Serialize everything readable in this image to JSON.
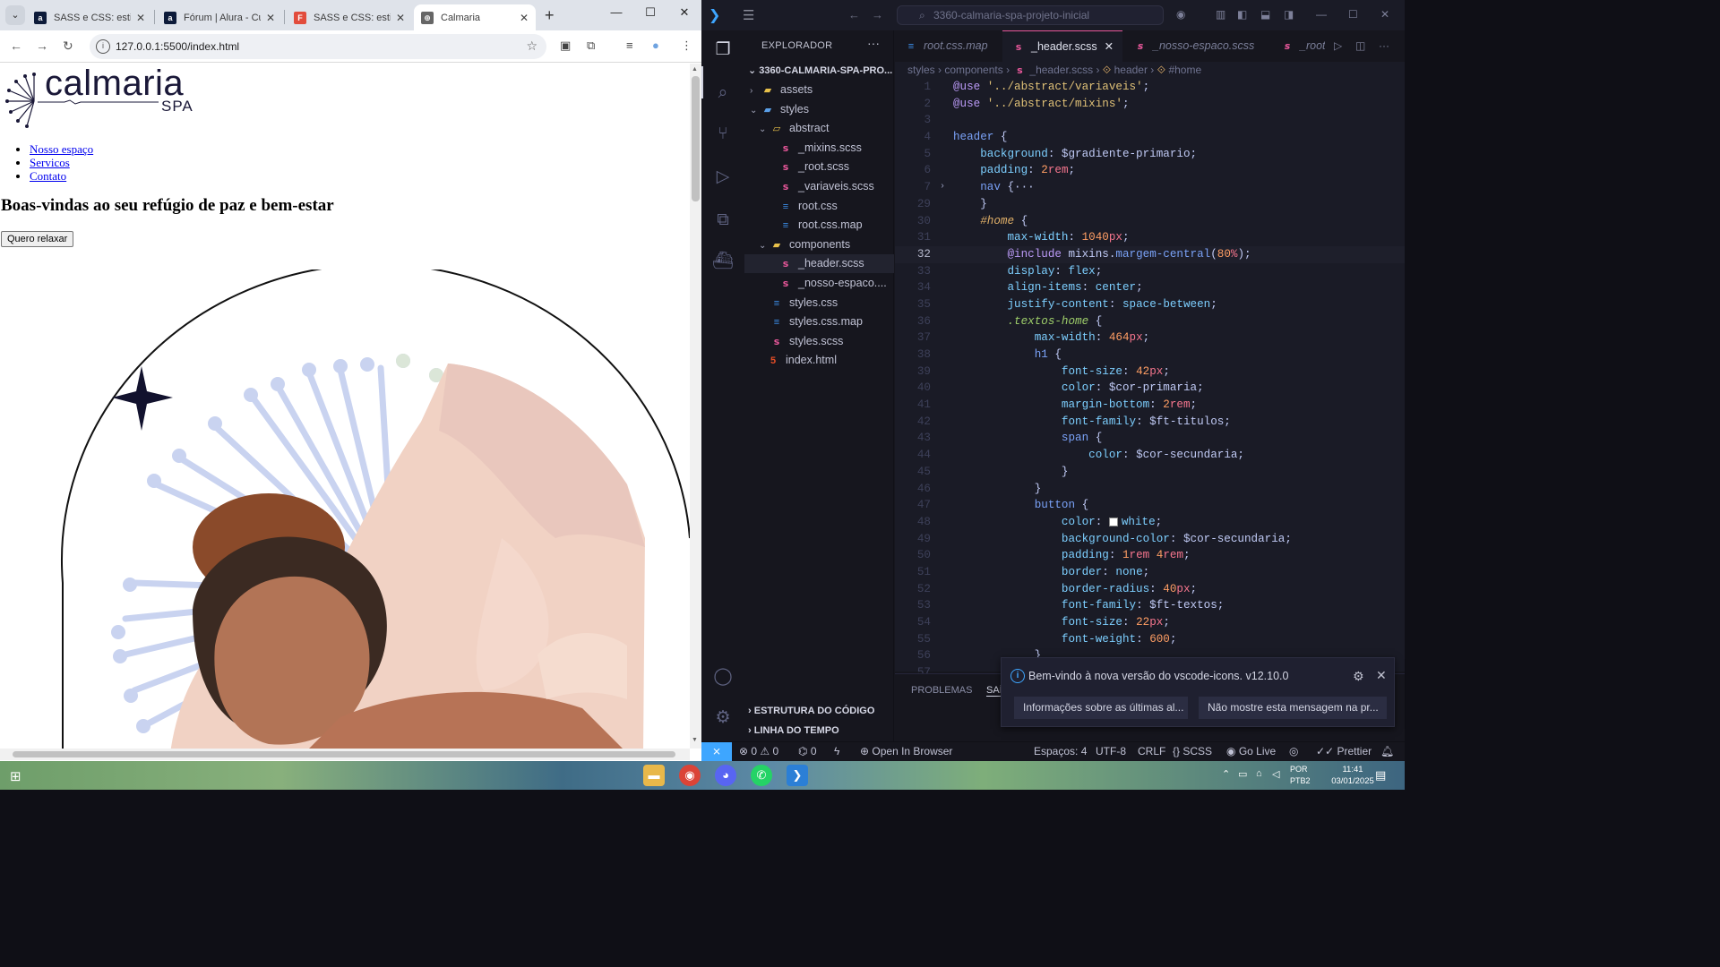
{
  "browser": {
    "tabs": [
      {
        "title": "SASS e CSS: estiliza",
        "favicon": "alura-icon",
        "fav_letter": "a",
        "color": "#0d1b3a"
      },
      {
        "title": "Fórum | Alura - Cur",
        "favicon": "alura-icon",
        "fav_letter": "a",
        "color": "#0d1b3a"
      },
      {
        "title": "SASS e CSS: estiliza",
        "favicon": "figma-icon",
        "fav_letter": "F",
        "color": "#e24c3c"
      },
      {
        "title": "Calmaria",
        "favicon": "globe-icon",
        "fav_letter": "⊕",
        "color": "#666666",
        "active": true
      }
    ],
    "url": "127.0.0.1:5500/index.html",
    "page": {
      "logo_word": "calmaria",
      "logo_sub": "SPA",
      "nav_links": [
        "Nosso espaço",
        "Servicos",
        "Contato"
      ],
      "heading": "Boas-vindas ao seu refúgio de paz e bem-estar",
      "button_label": "Quero relaxar"
    }
  },
  "vscode": {
    "search_text": "3360-calmaria-spa-projeto-inicial",
    "explorer_title": "EXPLORADOR",
    "project_root": "3360-CALMARIA-SPA-PRO...",
    "tree": [
      {
        "label": "assets",
        "type": "folder",
        "depth": 0,
        "expanded": false
      },
      {
        "label": "styles",
        "type": "folder-blue",
        "depth": 0,
        "expanded": true
      },
      {
        "label": "abstract",
        "type": "folder-open",
        "depth": 1,
        "expanded": true
      },
      {
        "label": "_mixins.scss",
        "type": "sass",
        "depth": 2
      },
      {
        "label": "_root.scss",
        "type": "sass",
        "depth": 2
      },
      {
        "label": "_variaveis.scss",
        "type": "sass",
        "depth": 2
      },
      {
        "label": "root.css",
        "type": "css",
        "depth": 2
      },
      {
        "label": "root.css.map",
        "type": "css",
        "depth": 2
      },
      {
        "label": "components",
        "type": "folder",
        "depth": 1,
        "expanded": true
      },
      {
        "label": "_header.scss",
        "type": "sass",
        "depth": 2,
        "selected": true
      },
      {
        "label": "_nosso-espaco....",
        "type": "sass",
        "depth": 2
      },
      {
        "label": "styles.css",
        "type": "css",
        "depth": 1
      },
      {
        "label": "styles.css.map",
        "type": "css",
        "depth": 1
      },
      {
        "label": "styles.scss",
        "type": "sass",
        "depth": 1
      },
      {
        "label": "index.html",
        "type": "html",
        "depth": 0
      }
    ],
    "sections": [
      "ESTRUTURA DO CÓDIGO",
      "LINHA DO TEMPO"
    ],
    "editor_tabs": [
      {
        "label": "root.css.map",
        "type": "css"
      },
      {
        "label": "_header.scss",
        "type": "sass",
        "active": true
      },
      {
        "label": "_nosso-espaco.scss",
        "type": "sass"
      },
      {
        "label": "_root",
        "type": "sass"
      }
    ],
    "breadcrumb": [
      "styles",
      "components",
      "_header.scss",
      "header",
      "#home"
    ],
    "current_line": 32,
    "code_lines": [
      {
        "n": 1,
        "html": "<span class='k'>@use</span> <span class='s'>'../abstract/variaveis'</span><span class='p'>;</span>"
      },
      {
        "n": 2,
        "html": "<span class='k'>@use</span> <span class='s'>'../abstract/mixins'</span><span class='p'>;</span>"
      },
      {
        "n": 3,
        "html": ""
      },
      {
        "n": 4,
        "html": "<span class='fn'>header</span> <span class='p'>{</span>"
      },
      {
        "n": 5,
        "html": "    <span class='prop'>background</span><span class='p'>: $gradiente-primario;</span>"
      },
      {
        "n": 6,
        "html": "    <span class='prop'>padding</span><span class='p'>: </span><span class='n'>2</span><span class='u'>rem</span><span class='p'>;</span>"
      },
      {
        "n": 7,
        "html": "    <span class='fn'>nav</span> <span class='p'>{···</span>",
        "fold": true
      },
      {
        "n": 29,
        "html": "    <span class='p'>}</span>"
      },
      {
        "n": 30,
        "html": "    <span class='hash'>#home</span> <span class='p'>{</span>"
      },
      {
        "n": 31,
        "html": "        <span class='prop'>max-width</span><span class='p'>: </span><span class='n'>1040</span><span class='u'>px</span><span class='p'>;</span>"
      },
      {
        "n": 32,
        "html": "        <span class='k'>@include</span> <span class='p'>mixins.</span><span class='fn'>margem-central</span><span class='p'>(</span><span class='n'>80</span><span class='u'>%</span><span class='p'>);</span>"
      },
      {
        "n": 33,
        "html": "        <span class='prop'>display</span><span class='p'>: </span><span class='val'>flex</span><span class='p'>;</span>"
      },
      {
        "n": 34,
        "html": "        <span class='prop'>align-items</span><span class='p'>: </span><span class='val'>center</span><span class='p'>;</span>"
      },
      {
        "n": 35,
        "html": "        <span class='prop'>justify-content</span><span class='p'>: </span><span class='val'>space-between</span><span class='p'>;</span>"
      },
      {
        "n": 36,
        "html": "        <span class='dotc'>.textos-home</span> <span class='p'>{</span>"
      },
      {
        "n": 37,
        "html": "            <span class='prop'>max-width</span><span class='p'>: </span><span class='n'>464</span><span class='u'>px</span><span class='p'>;</span>"
      },
      {
        "n": 38,
        "html": "            <span class='fn'>h1</span> <span class='p'>{</span>"
      },
      {
        "n": 39,
        "html": "                <span class='prop'>font-size</span><span class='p'>: </span><span class='n'>42</span><span class='u'>px</span><span class='p'>;</span>"
      },
      {
        "n": 40,
        "html": "                <span class='prop'>color</span><span class='p'>: $cor-primaria;</span>"
      },
      {
        "n": 41,
        "html": "                <span class='prop'>margin-bottom</span><span class='p'>: </span><span class='n'>2</span><span class='u'>rem</span><span class='p'>;</span>"
      },
      {
        "n": 42,
        "html": "                <span class='prop'>font-family</span><span class='p'>: $ft-titulos;</span>"
      },
      {
        "n": 43,
        "html": "                <span class='fn'>span</span> <span class='p'>{</span>"
      },
      {
        "n": 44,
        "html": "                    <span class='prop'>color</span><span class='p'>: $cor-secundaria;</span>"
      },
      {
        "n": 45,
        "html": "                <span class='p'>}</span>"
      },
      {
        "n": 46,
        "html": "            <span class='p'>}</span>"
      },
      {
        "n": 47,
        "html": "            <span class='fn'>button</span> <span class='p'>{</span>"
      },
      {
        "n": 48,
        "html": "                <span class='prop'>color</span><span class='p'>: </span><span class='swatch'></span><span class='val'>white</span><span class='p'>;</span>"
      },
      {
        "n": 49,
        "html": "                <span class='prop'>background-color</span><span class='p'>: $cor-secundaria;</span>"
      },
      {
        "n": 50,
        "html": "                <span class='prop'>padding</span><span class='p'>: </span><span class='n'>1</span><span class='u'>rem</span> <span class='n'>4</span><span class='u'>rem</span><span class='p'>;</span>"
      },
      {
        "n": 51,
        "html": "                <span class='prop'>border</span><span class='p'>: </span><span class='val'>none</span><span class='p'>;</span>"
      },
      {
        "n": 52,
        "html": "                <span class='prop'>border-radius</span><span class='p'>: </span><span class='n'>40</span><span class='u'>px</span><span class='p'>;</span>"
      },
      {
        "n": 53,
        "html": "                <span class='prop'>font-family</span><span class='p'>: $ft-textos;</span>"
      },
      {
        "n": 54,
        "html": "                <span class='prop'>font-size</span><span class='p'>: </span><span class='n'>22</span><span class='u'>px</span><span class='p'>;</span>"
      },
      {
        "n": 55,
        "html": "                <span class='prop'>font-weight</span><span class='p'>: </span><span class='n'>600</span><span class='p'>;</span>"
      },
      {
        "n": 56,
        "html": "            <span class='p'>}</span>"
      },
      {
        "n": 57,
        "html": ""
      }
    ],
    "panel_tabs": [
      "PROBLEMAS",
      "SAÍ"
    ],
    "notification": {
      "message": "Bem-vindo à nova versão do vscode-icons. v12.10.0",
      "button1": "Informações sobre as últimas al...",
      "button2": "Não mostre esta mensagem na pr..."
    },
    "status": {
      "errors": "0",
      "warnings": "0",
      "ports": "0",
      "open_in_browser": "Open In Browser",
      "spaces": "Espaços: 4",
      "encoding": "UTF-8",
      "eol": "CRLF",
      "language": "SCSS",
      "go_live": "Go Live",
      "prettier": "Prettier"
    }
  },
  "taskbar": {
    "lang_top": "POR",
    "lang_bottom": "PTB2",
    "time": "11:41",
    "date": "03/01/2025"
  }
}
